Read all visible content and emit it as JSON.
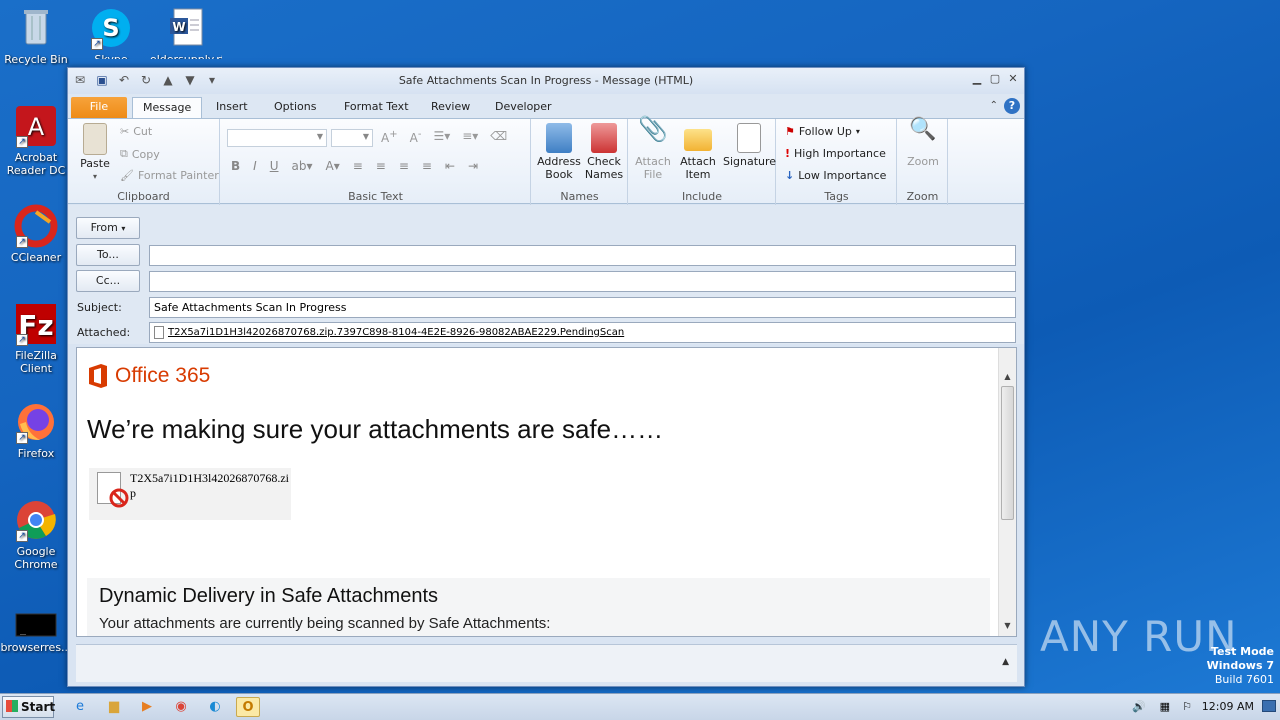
{
  "desktop": {
    "icons": [
      {
        "label": "Recycle Bin",
        "icon": "recycle-bin-icon"
      },
      {
        "label": "Skype",
        "icon": "skype-icon"
      },
      {
        "label": "oldersupply.rtf",
        "icon": "word-document-icon"
      },
      {
        "label": "Acrobat Reader DC",
        "icon": "acrobat-icon"
      },
      {
        "label": "CCleaner",
        "icon": "ccleaner-icon"
      },
      {
        "label": "FileZilla Client",
        "icon": "filezilla-icon"
      },
      {
        "label": "Firefox",
        "icon": "firefox-icon"
      },
      {
        "label": "Google Chrome",
        "icon": "chrome-icon"
      },
      {
        "label": "browserres...",
        "icon": "console-icon"
      }
    ]
  },
  "window": {
    "title": "Safe Attachments Scan In Progress - Message (HTML)"
  },
  "ribbon": {
    "tabs": [
      "File",
      "Message",
      "Insert",
      "Options",
      "Format Text",
      "Review",
      "Developer"
    ],
    "active_tab": "Message",
    "clipboard": {
      "paste": "Paste",
      "cut": "Cut",
      "copy": "Copy",
      "format_painter": "Format Painter",
      "label": "Clipboard"
    },
    "basic_text": {
      "label": "Basic Text"
    },
    "names": {
      "address_book": "Address Book",
      "check_names": "Check Names",
      "label": "Names"
    },
    "include": {
      "attach_file": "Attach File",
      "attach_item": "Attach Item",
      "signature": "Signature",
      "label": "Include"
    },
    "tags": {
      "follow_up": "Follow Up",
      "high_importance": "High Importance",
      "low_importance": "Low Importance",
      "label": "Tags"
    },
    "zoom": {
      "zoom": "Zoom",
      "label": "Zoom"
    }
  },
  "form": {
    "from_label": "From",
    "to_label": "To...",
    "cc_label": "Cc...",
    "to_value": "",
    "cc_value": "",
    "subject_label": "Subject:",
    "subject_value": "Safe Attachments Scan In Progress",
    "attached_label": "Attached:",
    "attachment_name": "T2X5a7i1D1H3l42026870768.zip.7397C898-8104-4E2E-8926-98082ABAE229.PendingScan"
  },
  "message": {
    "brand": "Office 365",
    "heading": "We’re making sure your attachments are safe……",
    "file_name_line1": "T2X5a7i1D1H3l42026870768.zi",
    "file_name_line2": "p",
    "section_title": "Dynamic Delivery in Safe Attachments",
    "section_text": "Your attachments are currently being scanned by Safe Attachments:"
  },
  "taskbar": {
    "start": "Start",
    "clock": "12:09 AM"
  },
  "watermark": {
    "line1": "Test Mode",
    "line2": "Windows 7",
    "line3": "Build 7601",
    "brand": "ANY RUN"
  },
  "colors": {
    "accent": "#ee8b17",
    "office_red": "#d83b01",
    "ribbon_bg": "#fbfcfe"
  }
}
